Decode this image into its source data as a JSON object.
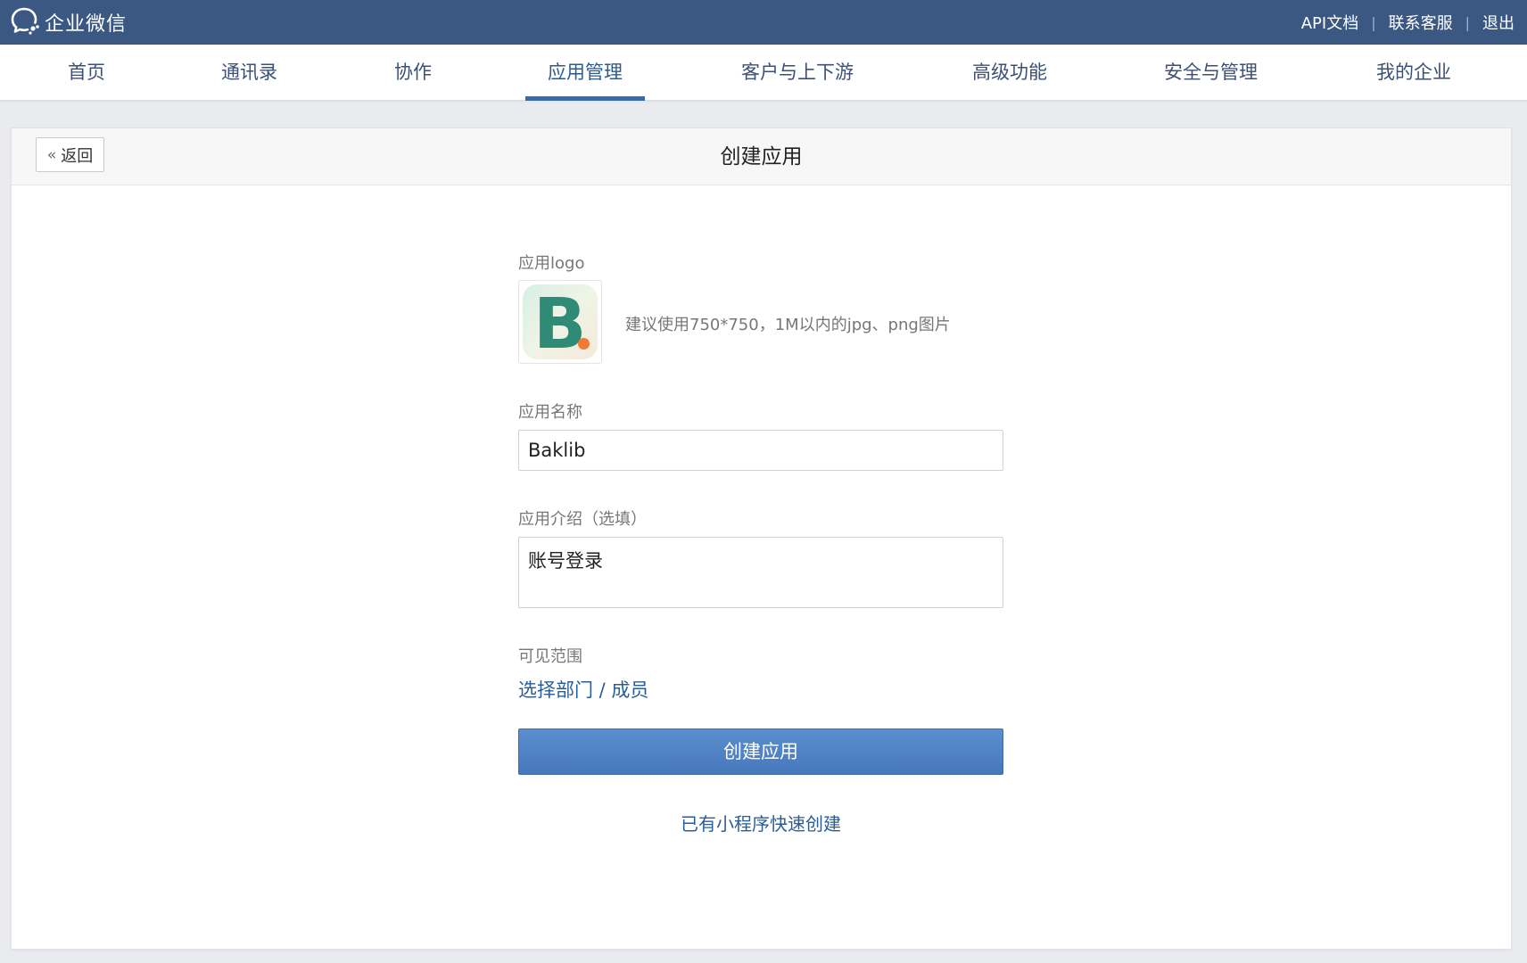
{
  "topbar": {
    "brand": "企业微信",
    "links": {
      "api_docs": "API文档",
      "support": "联系客服",
      "logout": "退出"
    },
    "separator": "|"
  },
  "nav": {
    "tabs": [
      {
        "label": "首页"
      },
      {
        "label": "通讯录"
      },
      {
        "label": "协作"
      },
      {
        "label": "应用管理"
      },
      {
        "label": "客户与上下游"
      },
      {
        "label": "高级功能"
      },
      {
        "label": "安全与管理"
      },
      {
        "label": "我的企业"
      }
    ],
    "active": "应用管理"
  },
  "page": {
    "back_label": "返回",
    "title": "创建应用"
  },
  "form": {
    "logo_label": "应用logo",
    "logo_letter": "B",
    "logo_hint": "建议使用750*750，1M以内的jpg、png图片",
    "name_label": "应用名称",
    "name_value": "Baklib",
    "intro_label": "应用介绍（选填）",
    "intro_value": "账号登录",
    "scope_label": "可见范围",
    "scope_link": "选择部门 / 成员",
    "create_button": "创建应用",
    "quick_create_link": "已有小程序快速创建"
  },
  "colors": {
    "topbar_bg": "#3b5883",
    "accent": "#4677ba",
    "link": "#2b5c95",
    "logo_green": "#2f8a76",
    "logo_orange": "#ef7a35"
  }
}
